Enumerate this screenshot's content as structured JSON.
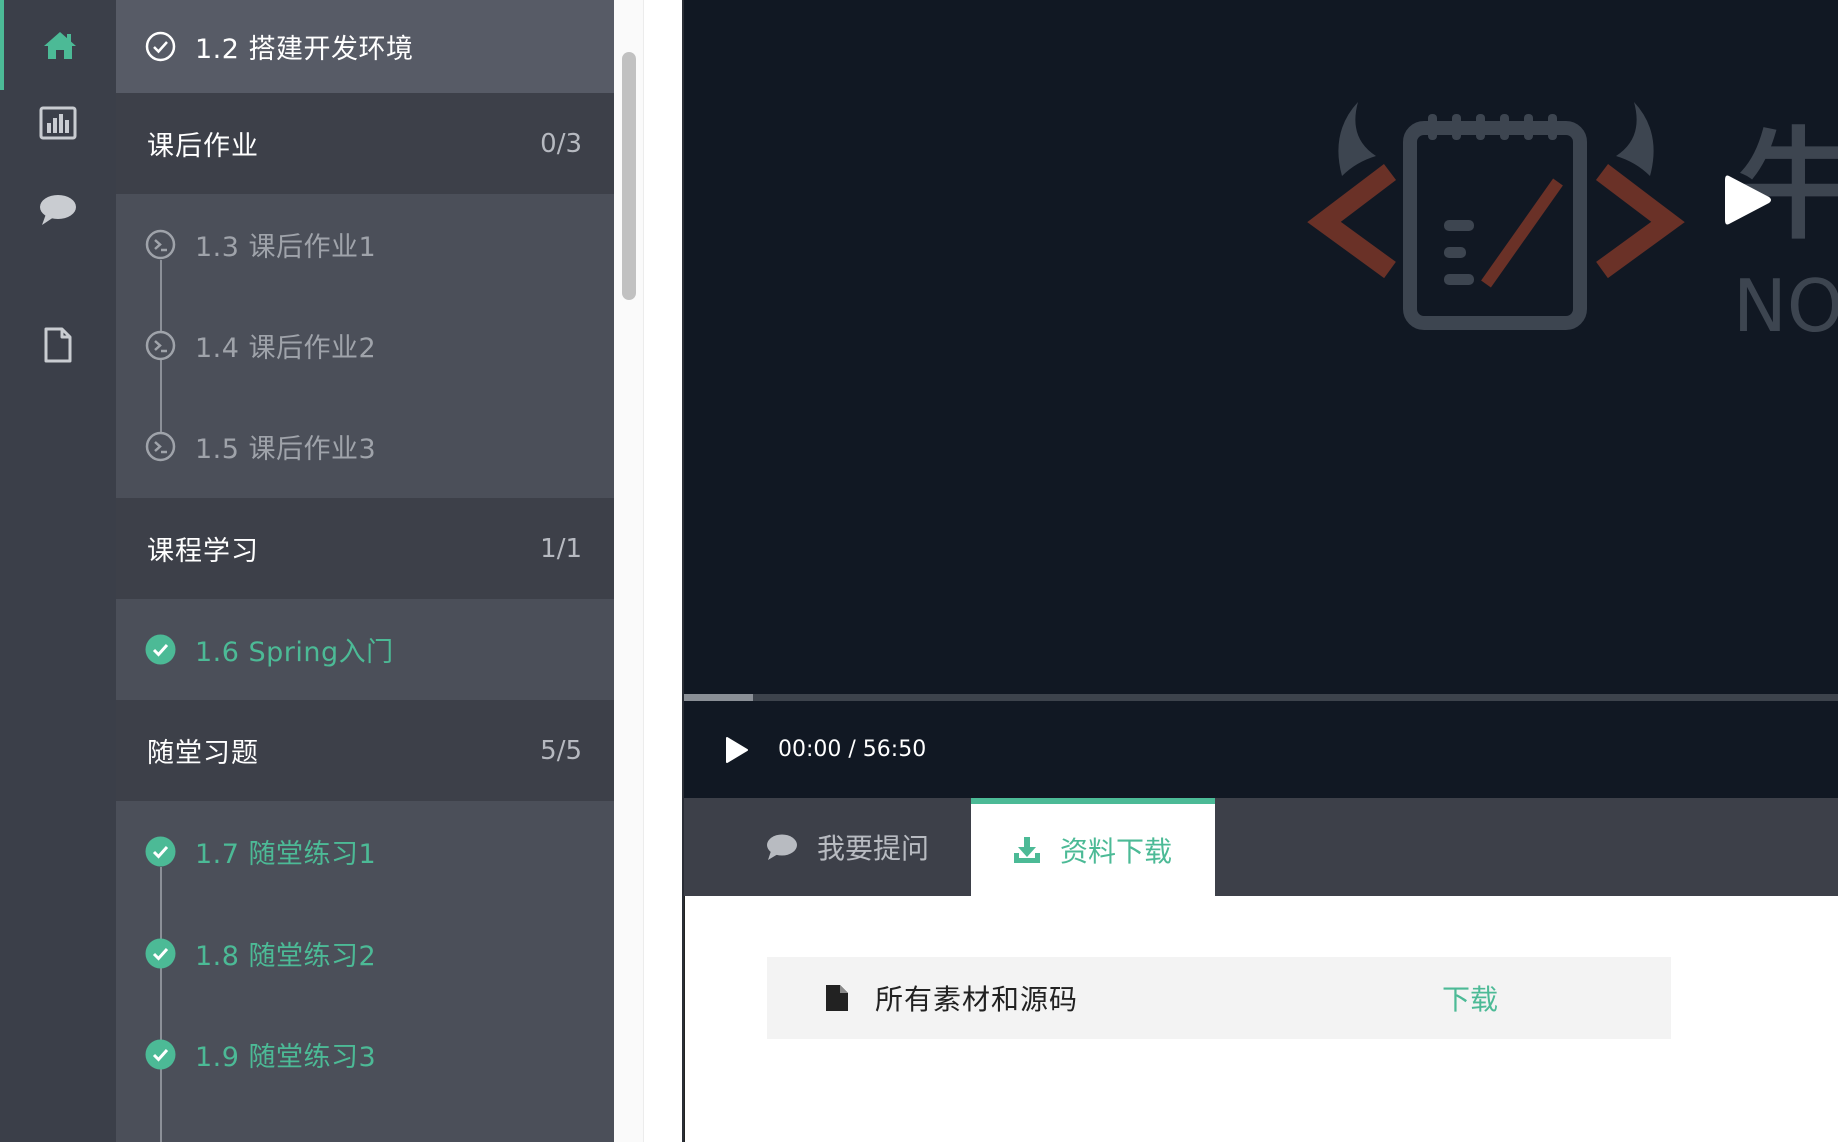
{
  "nav_rail": {
    "items": [
      {
        "icon": "home-icon",
        "active": true
      },
      {
        "icon": "stats-icon",
        "active": false
      },
      {
        "icon": "comment-icon",
        "active": false
      },
      {
        "icon": "document-icon",
        "active": false
      }
    ]
  },
  "course_list": {
    "top_lesson": {
      "label": "1.2 搭建开发环境",
      "status": "done"
    },
    "sections": [
      {
        "title": "课后作业",
        "count": "0/3",
        "lessons": [
          {
            "label": "1.3 课后作业1",
            "status": "pending"
          },
          {
            "label": "1.4 课后作业2",
            "status": "pending"
          },
          {
            "label": "1.5 课后作业3",
            "status": "pending"
          }
        ]
      },
      {
        "title": "课程学习",
        "count": "1/1",
        "lessons": [
          {
            "label": "1.6 Spring入门",
            "status": "done"
          }
        ]
      },
      {
        "title": "随堂习题",
        "count": "5/5",
        "lessons": [
          {
            "label": "1.7 随堂练习1",
            "status": "done"
          },
          {
            "label": "1.8 随堂练习2",
            "status": "done"
          },
          {
            "label": "1.9 随堂练习3",
            "status": "done"
          }
        ]
      }
    ]
  },
  "player": {
    "time": "00:00 / 56:50",
    "watermark_text_1": "牛",
    "watermark_text_2": "NO",
    "buffered_fraction": 0.06
  },
  "tabs": {
    "ask": "我要提问",
    "download": "资料下载",
    "active": "download"
  },
  "downloads": {
    "items": [
      {
        "name": "所有素材和源码",
        "action": "下载"
      }
    ]
  },
  "colors": {
    "accent": "#4cba96",
    "rail_bg": "#3b3f49",
    "sidebar_bg": "#4b4f59",
    "video_bg": "#111823"
  }
}
